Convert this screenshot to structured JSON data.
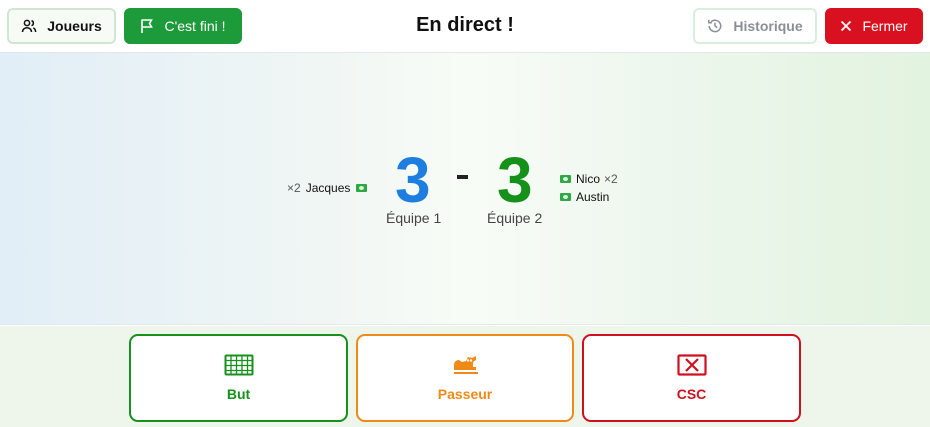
{
  "header": {
    "players_label": "Joueurs",
    "finish_label": "C'est fini !",
    "title": "En direct !",
    "history_label": "Historique",
    "close_label": "Fermer"
  },
  "score": {
    "team1": {
      "name": "Équipe 1",
      "goals": "3"
    },
    "team2": {
      "name": "Équipe 2",
      "goals": "3"
    },
    "separator": "-"
  },
  "scorers": {
    "team1": [
      {
        "name": "Jacques",
        "multiplier": "×2"
      }
    ],
    "team2": [
      {
        "name": "Nico",
        "multiplier": "×2"
      },
      {
        "name": "Austin",
        "multiplier": ""
      }
    ]
  },
  "actions": {
    "goal_label": "But",
    "assist_label": "Passeur",
    "own_goal_label": "CSC"
  },
  "colors": {
    "team1": "#1d7ee0",
    "team2": "#159018",
    "finish_button": "#1d9a3a",
    "close_button": "#d8101f",
    "assist": "#f08a17"
  },
  "icons": {
    "players": "users-icon",
    "finish": "flag-icon",
    "history": "history-icon",
    "close": "close-icon",
    "goal": "goal-net-icon",
    "assist": "running-shoe-icon",
    "own_goal": "crossed-goal-icon"
  }
}
